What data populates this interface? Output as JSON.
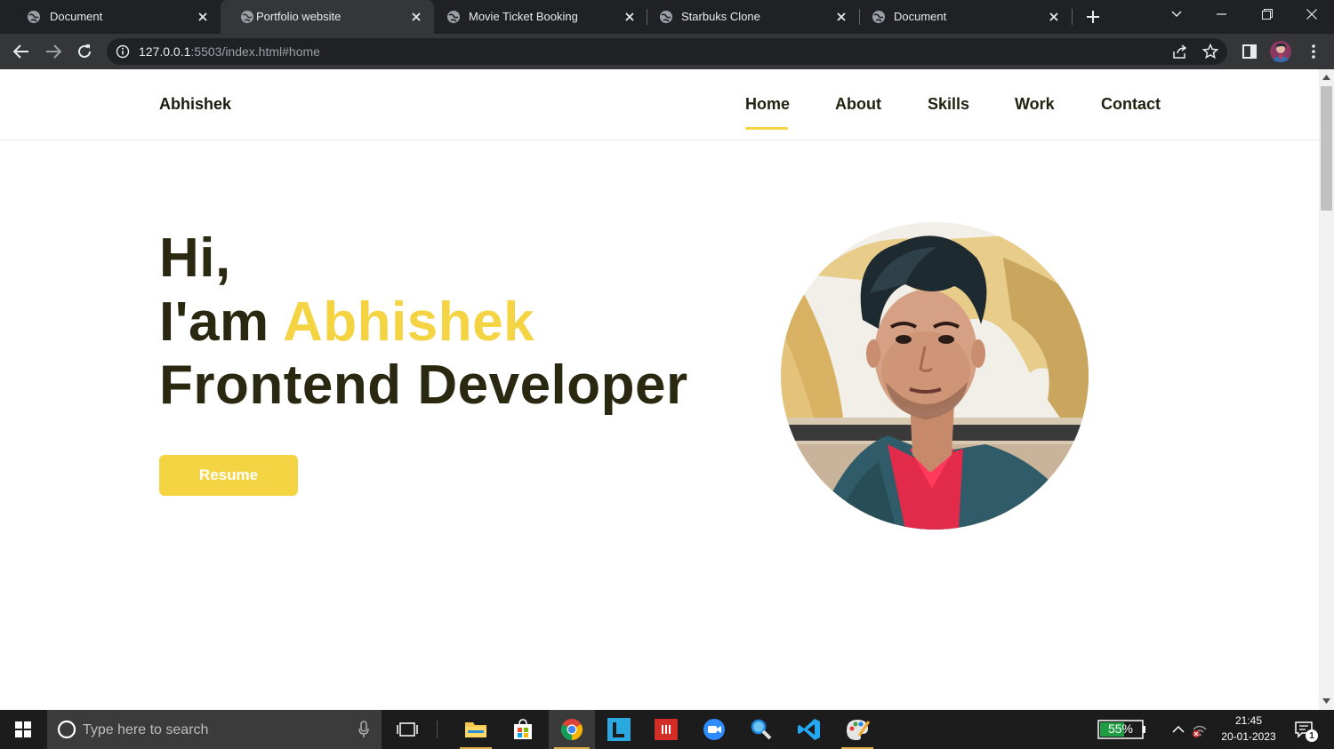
{
  "browser": {
    "tabs": [
      {
        "title": "Document",
        "active": false
      },
      {
        "title": "Portfolio website",
        "active": true
      },
      {
        "title": "Movie Ticket Booking",
        "active": false
      },
      {
        "title": "Starbuks Clone",
        "active": false
      },
      {
        "title": "Document",
        "active": false
      }
    ],
    "url_host": "127.0.0.1",
    "url_rest": ":5503/index.html#home"
  },
  "site": {
    "brand": "Abhishek",
    "nav": [
      "Home",
      "About",
      "Skills",
      "Work",
      "Contact"
    ],
    "active_nav": "Home",
    "hero": {
      "greeting": "Hi,",
      "intro": "I'am ",
      "name": "Abhishek",
      "role": "Frontend Developer"
    },
    "resume_label": "Resume",
    "accent_color": "#f4d443"
  },
  "taskbar": {
    "search_placeholder": "Type here to search",
    "battery": "55%",
    "time": "21:45",
    "date": "20-01-2023",
    "notification_count": "1"
  }
}
